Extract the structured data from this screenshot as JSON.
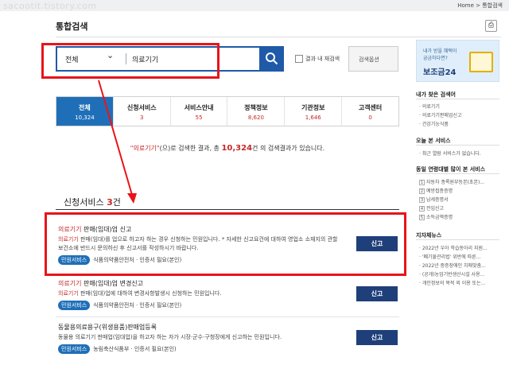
{
  "watermark": "sacootit.tistory.com",
  "breadcrumb": {
    "home": "Home",
    "sep": ">",
    "current": "통합검색"
  },
  "page_title": "통합검색",
  "print_icon": "printer-icon",
  "search": {
    "scope": "전체",
    "value": "의료기기",
    "within_label": "결과 내 재검색",
    "options_label": "검색옵션"
  },
  "tabs": [
    {
      "label": "전체",
      "count": "10,324",
      "active": true
    },
    {
      "label": "신청서비스",
      "count": "3",
      "active": false
    },
    {
      "label": "서비스안내",
      "count": "55",
      "active": false
    },
    {
      "label": "정책정보",
      "count": "8,620",
      "active": false
    },
    {
      "label": "기관정보",
      "count": "1,646",
      "active": false
    },
    {
      "label": "고객센터",
      "count": "0",
      "active": false
    }
  ],
  "result": {
    "pre": "\"의료기기\"",
    "mid": "(으)로 검색한 결과, 총 ",
    "count": "10,324",
    "post": "건 의 검색결과가 있습니다."
  },
  "section": {
    "title": "신청서비스 ",
    "count": "3",
    "unit": "건"
  },
  "items": [
    {
      "title_hl": "의료기기",
      "title_rest": " 판매(임대)업 신고",
      "desc_hl": "의료기기",
      "desc_rest": " 판매(임대)를 업으로 하고자 하는 경우 신청하는 민원입니다. * 자세한 신고요건에 대하여 영업소 소재지의 관할 보건소에 반드시 문의하신 후 신고서를 작성하시기 바랍니다.",
      "tag": "민원서비스",
      "org": "식품의약품안전처",
      "auth": "인증서 필요(본인)",
      "button": "신고"
    },
    {
      "title_hl": "의료기기",
      "title_rest": " 판매(임대)업 변경신고",
      "desc_hl": "의료기기",
      "desc_rest": " 판매(임대)업에 대하여 변경사항발생시 신청하는 민원입니다.",
      "tag": "민원서비스",
      "org": "식품의약품안전처",
      "auth": "인증서 필요(본인)",
      "button": "신고"
    },
    {
      "title_hl": "",
      "title_rest": "동물용의료용구(위생용품)판매업등록",
      "desc_hl": "",
      "desc_rest": "동물용 의료기기 판매업(임대업)을 하고자 하는 자가 시장·군수·구청장에게 신고하는 민원입니다.",
      "tag": "민원서비스",
      "org": "농림축산식품부",
      "auth": "인증서 필요(본인)",
      "button": "신고"
    }
  ],
  "sidebar": {
    "banner": {
      "line1": "내가 받을 혜택이",
      "line2": "궁금하다면?",
      "brand": "보조금24"
    },
    "recent_title": "내가 찾은 검색어",
    "recent": [
      "의료기기",
      "의료기기판매업신고",
      "건강기능식품"
    ],
    "today_title": "오늘 본 서비스",
    "today_empty": "최근 열람 서비스가 없습니다.",
    "popular_title": "동일 연령대별 많이 본 서비스",
    "popular": [
      "자동차 종록원부등본(초본)...",
      "예방접종증명",
      "납세증명서",
      "전입신고",
      "소득금액증명"
    ],
    "news_title": "지자체뉴스",
    "news": [
      "2022년 우아 학습동아리 지원...",
      "'폐기물관리법' 위반에 따른...",
      "2022년 중증장애인 치매맞춤...",
      "(공개)농업기반생산시설 사용...",
      "개인정보의 목적 외 이용 또는..."
    ]
  }
}
